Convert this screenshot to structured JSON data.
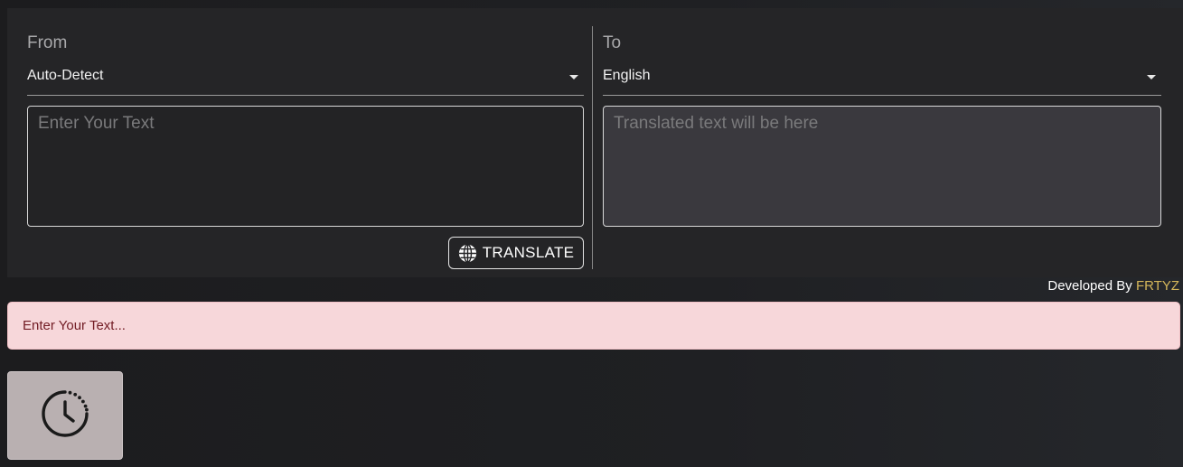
{
  "translator": {
    "from": {
      "label": "From",
      "selected_language": "Auto-Detect",
      "input_placeholder": "Enter Your Text",
      "input_value": ""
    },
    "to": {
      "label": "To",
      "selected_language": "English",
      "output_placeholder": "Translated text will be here",
      "output_value": ""
    },
    "translate_button": {
      "label": "TRANSLATE",
      "icon": "globe-icon"
    }
  },
  "footer": {
    "developed_by_label": "Developed By",
    "developer_name": "FRTYZ"
  },
  "alert": {
    "message": "Enter Your Text..."
  },
  "history_button": {
    "icon": "history-clock-icon"
  },
  "colors": {
    "panel_bg": "#252527",
    "alert_bg": "#f7d7da",
    "alert_text": "#721c24",
    "developer_name": "#d4b65a",
    "history_button_bg": "#b9b0b1"
  }
}
